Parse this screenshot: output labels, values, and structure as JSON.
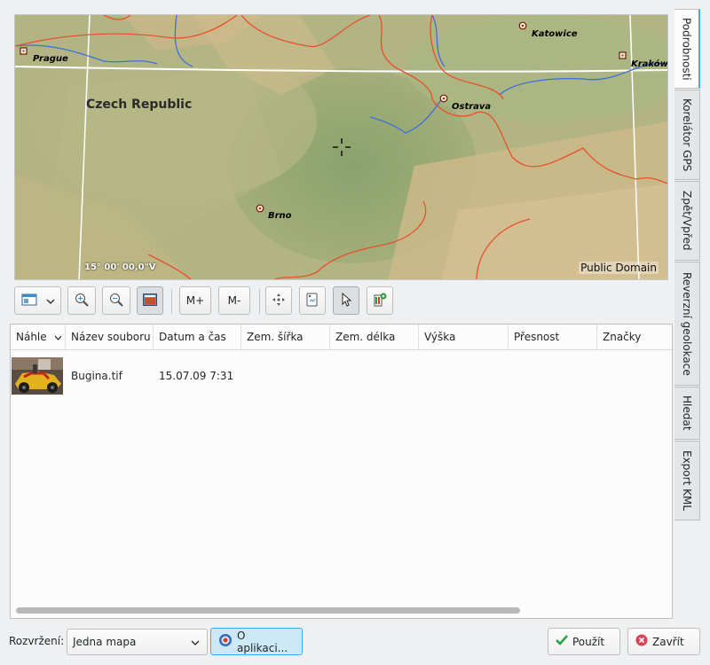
{
  "map": {
    "country_label": "Czech Republic",
    "cities": [
      {
        "name": "Prague"
      },
      {
        "name": "Katowice"
      },
      {
        "name": "Kraków"
      },
      {
        "name": "Ostrava"
      },
      {
        "name": "Brno"
      }
    ],
    "coordinates": "15° 00' 00,0\"V",
    "attribution": "Public Domain",
    "colors": {
      "terrain": "#a9b07f",
      "border": "#e8502c",
      "river": "#3c6fd9",
      "grid": "#ffffff"
    }
  },
  "toolbar": {
    "items": [
      {
        "icon": "map-view-icon",
        "dropdown": true
      },
      {
        "icon": "zoom-in-icon"
      },
      {
        "icon": "zoom-out-icon"
      },
      {
        "icon": "overview-map-icon",
        "active": true
      },
      {
        "label": "M+"
      },
      {
        "label": "M-"
      },
      {
        "icon": "center-icon"
      },
      {
        "icon": "bookmark-icon"
      },
      {
        "icon": "pointer-icon",
        "active": true
      },
      {
        "icon": "add-marker-icon"
      }
    ]
  },
  "table": {
    "columns": [
      "Náhle",
      "Název souboru",
      "Datum a čas",
      "Zem. šířka",
      "Zem. délka",
      "Výška",
      "Přesnost",
      "Značky"
    ],
    "rows": [
      {
        "filename": "Bugina.tif",
        "datetime": "15.07.09 7:31",
        "latitude": "",
        "longitude": "",
        "altitude": "",
        "accuracy": "",
        "tags": ""
      }
    ]
  },
  "side_tabs": [
    "Podrobnosti",
    "Korelátor GPS",
    "Zpět/Vpřed",
    "Reverzní geolokace",
    "Hledat",
    "Export KML"
  ],
  "bottom": {
    "layout_label": "Rozvržení:",
    "layout_value": "Jedna mapa",
    "about_label": "O aplikaci...",
    "apply_label": "Použít",
    "close_label": "Zavřít"
  }
}
